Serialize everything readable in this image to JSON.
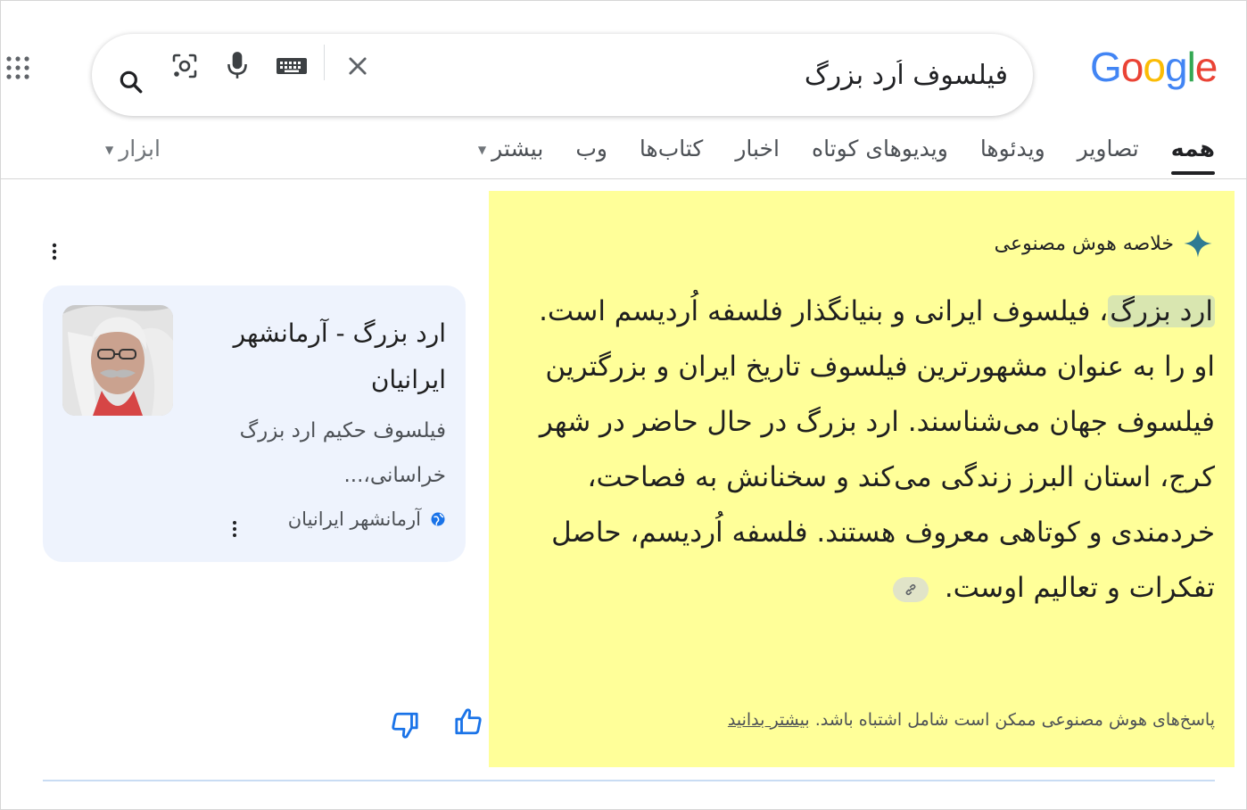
{
  "logo": {
    "letters": [
      "G",
      "o",
      "o",
      "g",
      "l",
      "e"
    ],
    "colors": [
      "#4285f4",
      "#ea4335",
      "#fbbc05",
      "#4285f4",
      "#34a853",
      "#ea4335"
    ]
  },
  "search": {
    "query": "فیلسوف اُرد بزرگ"
  },
  "icons": {
    "apps": "apps-grid-icon",
    "search": "search-icon",
    "lens": "camera-lens-icon",
    "mic": "microphone-icon",
    "keyboard": "keyboard-icon",
    "clear": "close-icon"
  },
  "tabs": [
    {
      "label": "همه",
      "active": true
    },
    {
      "label": "تصاویر"
    },
    {
      "label": "ویدئوها"
    },
    {
      "label": "ویدیوهای کوتاه"
    },
    {
      "label": "اخبار"
    },
    {
      "label": "کتاب‌ها"
    },
    {
      "label": "وب"
    },
    {
      "label": "بیشتر"
    }
  ],
  "tools": {
    "label": "ابزار"
  },
  "ai_overview": {
    "header": "خلاصه هوش مصنوعی",
    "highlight": "ارد بزرگ",
    "body": "، فیلسوف ایرانی و بنیانگذار فلسفه اُردیسم است. او را به عنوان مشهورترین فیلسوف تاریخ ایران و بزرگترین فیلسوف جهان می‌شناسند. ارد بزرگ در حال حاضر در شهر کرج، استان البرز زندگی می‌کند و سخنانش به فصاحت، خردمندی و کوتاهی معروف هستند. فلسفه اُردیسم، حاصل تفکرات و تعالیم اوست.",
    "disclaimer": "پاسخ‌های هوش مصنوعی ممکن است شامل اشتباه باشد.",
    "learn_more": "بیشتر بدانید",
    "bg_color": "#ffff99"
  },
  "source_card": {
    "title": "ارد بزرگ - آرمانشهر ایرانیان",
    "snippet": "فیلسوف حکیم ارد بزرگ خراسانی،...",
    "source": "آرمانشهر ایرانیان"
  },
  "feedback": {
    "up": "thumbs-up-icon",
    "down": "thumbs-down-icon"
  }
}
